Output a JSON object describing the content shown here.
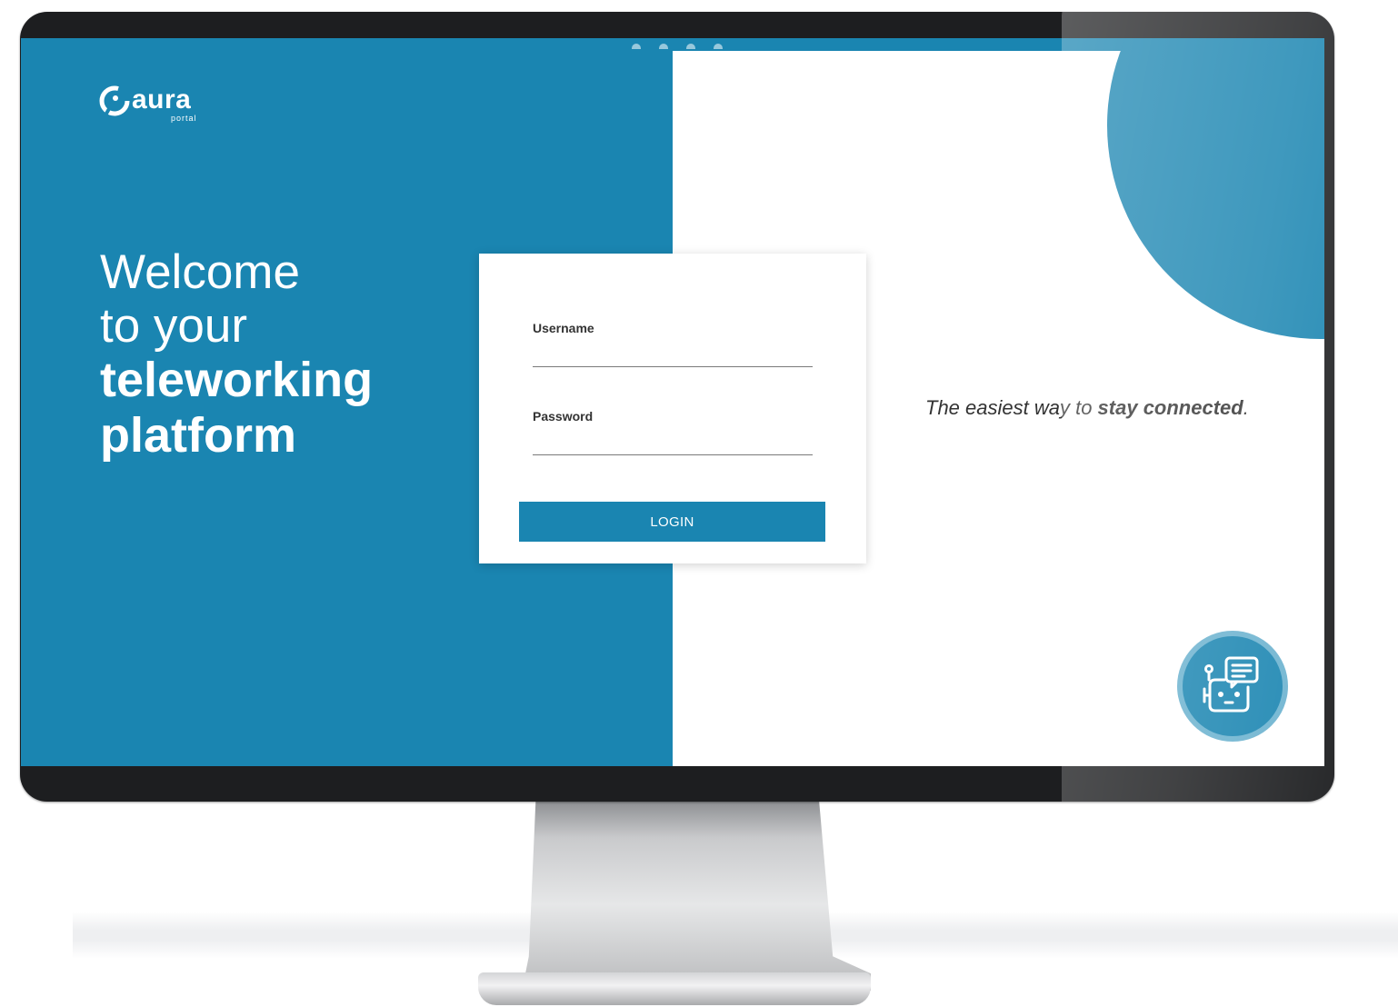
{
  "brand": {
    "name": "aura",
    "subname": "portal"
  },
  "hero": {
    "line1": "Welcome",
    "line2": "to your",
    "line3": "teleworking",
    "line4": "platform"
  },
  "login": {
    "username_label": "Username",
    "username_value": "",
    "password_label": "Password",
    "password_value": "",
    "button_label": "LOGIN"
  },
  "tagline": {
    "prefix": "The easiest way to ",
    "emphasis": "stay connected",
    "suffix": "."
  },
  "icons": {
    "logo": "aura-logo-icon",
    "chatbot": "chatbot-icon"
  },
  "colors": {
    "brand_blue": "#1a85b1",
    "bezel": "#1d1e20",
    "text": "#333333"
  }
}
